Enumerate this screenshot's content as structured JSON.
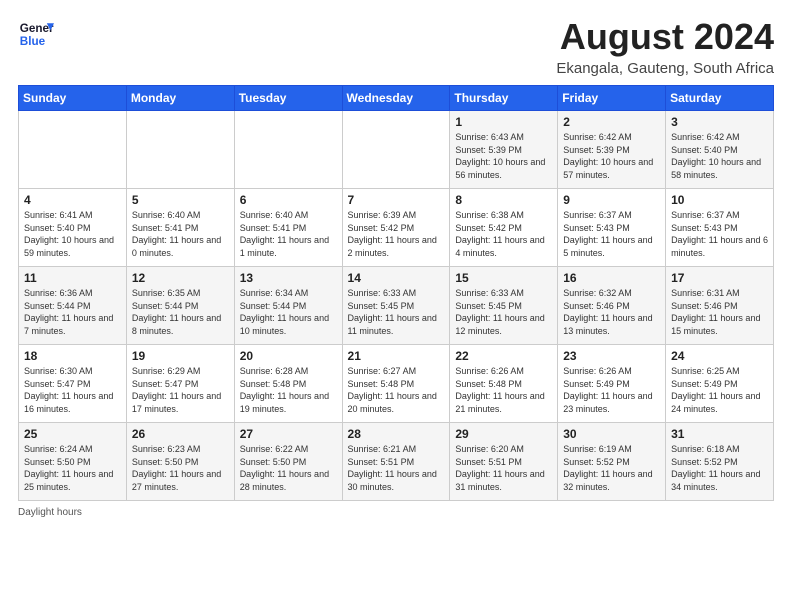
{
  "header": {
    "logo_line1": "General",
    "logo_line2": "Blue",
    "title": "August 2024",
    "subtitle": "Ekangala, Gauteng, South Africa"
  },
  "days_of_week": [
    "Sunday",
    "Monday",
    "Tuesday",
    "Wednesday",
    "Thursday",
    "Friday",
    "Saturday"
  ],
  "weeks": [
    [
      {
        "day": "",
        "info": ""
      },
      {
        "day": "",
        "info": ""
      },
      {
        "day": "",
        "info": ""
      },
      {
        "day": "",
        "info": ""
      },
      {
        "day": "1",
        "info": "Sunrise: 6:43 AM\nSunset: 5:39 PM\nDaylight: 10 hours and 56 minutes."
      },
      {
        "day": "2",
        "info": "Sunrise: 6:42 AM\nSunset: 5:39 PM\nDaylight: 10 hours and 57 minutes."
      },
      {
        "day": "3",
        "info": "Sunrise: 6:42 AM\nSunset: 5:40 PM\nDaylight: 10 hours and 58 minutes."
      }
    ],
    [
      {
        "day": "4",
        "info": "Sunrise: 6:41 AM\nSunset: 5:40 PM\nDaylight: 10 hours and 59 minutes."
      },
      {
        "day": "5",
        "info": "Sunrise: 6:40 AM\nSunset: 5:41 PM\nDaylight: 11 hours and 0 minutes."
      },
      {
        "day": "6",
        "info": "Sunrise: 6:40 AM\nSunset: 5:41 PM\nDaylight: 11 hours and 1 minute."
      },
      {
        "day": "7",
        "info": "Sunrise: 6:39 AM\nSunset: 5:42 PM\nDaylight: 11 hours and 2 minutes."
      },
      {
        "day": "8",
        "info": "Sunrise: 6:38 AM\nSunset: 5:42 PM\nDaylight: 11 hours and 4 minutes."
      },
      {
        "day": "9",
        "info": "Sunrise: 6:37 AM\nSunset: 5:43 PM\nDaylight: 11 hours and 5 minutes."
      },
      {
        "day": "10",
        "info": "Sunrise: 6:37 AM\nSunset: 5:43 PM\nDaylight: 11 hours and 6 minutes."
      }
    ],
    [
      {
        "day": "11",
        "info": "Sunrise: 6:36 AM\nSunset: 5:44 PM\nDaylight: 11 hours and 7 minutes."
      },
      {
        "day": "12",
        "info": "Sunrise: 6:35 AM\nSunset: 5:44 PM\nDaylight: 11 hours and 8 minutes."
      },
      {
        "day": "13",
        "info": "Sunrise: 6:34 AM\nSunset: 5:44 PM\nDaylight: 11 hours and 10 minutes."
      },
      {
        "day": "14",
        "info": "Sunrise: 6:33 AM\nSunset: 5:45 PM\nDaylight: 11 hours and 11 minutes."
      },
      {
        "day": "15",
        "info": "Sunrise: 6:33 AM\nSunset: 5:45 PM\nDaylight: 11 hours and 12 minutes."
      },
      {
        "day": "16",
        "info": "Sunrise: 6:32 AM\nSunset: 5:46 PM\nDaylight: 11 hours and 13 minutes."
      },
      {
        "day": "17",
        "info": "Sunrise: 6:31 AM\nSunset: 5:46 PM\nDaylight: 11 hours and 15 minutes."
      }
    ],
    [
      {
        "day": "18",
        "info": "Sunrise: 6:30 AM\nSunset: 5:47 PM\nDaylight: 11 hours and 16 minutes."
      },
      {
        "day": "19",
        "info": "Sunrise: 6:29 AM\nSunset: 5:47 PM\nDaylight: 11 hours and 17 minutes."
      },
      {
        "day": "20",
        "info": "Sunrise: 6:28 AM\nSunset: 5:48 PM\nDaylight: 11 hours and 19 minutes."
      },
      {
        "day": "21",
        "info": "Sunrise: 6:27 AM\nSunset: 5:48 PM\nDaylight: 11 hours and 20 minutes."
      },
      {
        "day": "22",
        "info": "Sunrise: 6:26 AM\nSunset: 5:48 PM\nDaylight: 11 hours and 21 minutes."
      },
      {
        "day": "23",
        "info": "Sunrise: 6:26 AM\nSunset: 5:49 PM\nDaylight: 11 hours and 23 minutes."
      },
      {
        "day": "24",
        "info": "Sunrise: 6:25 AM\nSunset: 5:49 PM\nDaylight: 11 hours and 24 minutes."
      }
    ],
    [
      {
        "day": "25",
        "info": "Sunrise: 6:24 AM\nSunset: 5:50 PM\nDaylight: 11 hours and 25 minutes."
      },
      {
        "day": "26",
        "info": "Sunrise: 6:23 AM\nSunset: 5:50 PM\nDaylight: 11 hours and 27 minutes."
      },
      {
        "day": "27",
        "info": "Sunrise: 6:22 AM\nSunset: 5:50 PM\nDaylight: 11 hours and 28 minutes."
      },
      {
        "day": "28",
        "info": "Sunrise: 6:21 AM\nSunset: 5:51 PM\nDaylight: 11 hours and 30 minutes."
      },
      {
        "day": "29",
        "info": "Sunrise: 6:20 AM\nSunset: 5:51 PM\nDaylight: 11 hours and 31 minutes."
      },
      {
        "day": "30",
        "info": "Sunrise: 6:19 AM\nSunset: 5:52 PM\nDaylight: 11 hours and 32 minutes."
      },
      {
        "day": "31",
        "info": "Sunrise: 6:18 AM\nSunset: 5:52 PM\nDaylight: 11 hours and 34 minutes."
      }
    ]
  ],
  "footer": {
    "daylight_label": "Daylight hours"
  }
}
